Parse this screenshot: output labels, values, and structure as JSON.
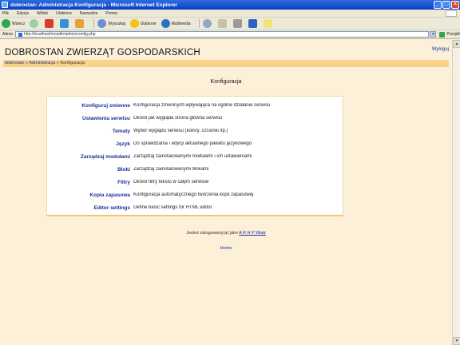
{
  "window": {
    "title": "dobrostan: Administracja Konfiguracja - Microsoft Internet Explorer"
  },
  "menu": [
    "Plik",
    "Edycja",
    "Widok",
    "Ulubione",
    "Narzędzia",
    "Pomoc"
  ],
  "toolbar": {
    "back": "Wstecz",
    "search": "Wyszukaj",
    "favorites": "Ulubione",
    "media": "Multimedia"
  },
  "address": {
    "label": "Adres",
    "url": "http://localhost/moodle/admin/config.php",
    "go": "Przejdź"
  },
  "site": {
    "name": "DOBROSTAN ZWIERZĄT GOSPODARSKICH",
    "login": "Wyloguj"
  },
  "breadcrumb": [
    "dobrostan",
    "Administracja",
    "Konfiguracja"
  ],
  "section_title": "Konfiguracja",
  "config_items": [
    {
      "link": "Konfiguruj zmienne",
      "desc": "Konfiguracja zmiennych wpływająca na ogólne działanie serwisu"
    },
    {
      "link": "Ustawienia serwisu",
      "desc": "Określ jak wygląda strona główna serwisu"
    },
    {
      "link": "Tematy",
      "desc": "Wybór wyglądu serwisu (kolory, czcionki itp.)"
    },
    {
      "link": "Język",
      "desc": "Do sprawdzania i edycji aktualnego pakietu językowego"
    },
    {
      "link": "Zarządzaj modułami",
      "desc": "Zarządzaj zainstalowanymi modułami i ich ustawieniami"
    },
    {
      "link": "Bloki",
      "desc": "Zarządzaj zainstalowanymi blokami"
    },
    {
      "link": "Filtry",
      "desc": "Określ filtry tekstu w całym serwisie"
    },
    {
      "link": "Kopia zapasowa",
      "desc": "Konfiguracja automatycznego tworzenia kopii zapasowej"
    },
    {
      "link": "Editor settings",
      "desc": "Define basic settings for HTML editor"
    }
  ],
  "footer": {
    "login_text": "Jesteś zalogowany(a) jako",
    "user": "A R H P Wiatr",
    "home": "Home"
  }
}
